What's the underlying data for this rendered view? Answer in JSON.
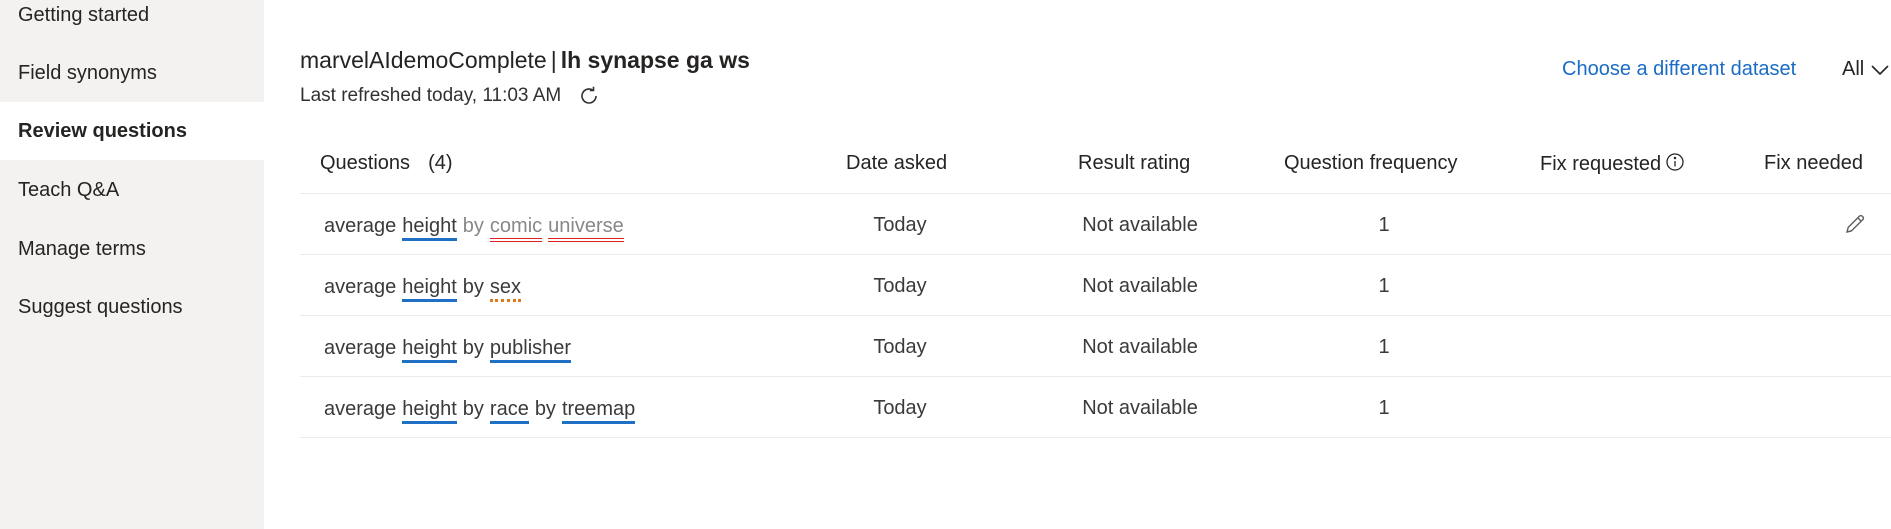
{
  "sidebar": {
    "items": [
      {
        "label": "Getting started",
        "active": false
      },
      {
        "label": "Field synonyms",
        "active": false
      },
      {
        "label": "Review questions",
        "active": true
      },
      {
        "label": "Teach Q&A",
        "active": false
      },
      {
        "label": "Manage terms",
        "active": false
      },
      {
        "label": "Suggest questions",
        "active": false
      }
    ]
  },
  "header": {
    "dataset": "marvelAIdemoComplete",
    "separator": "|",
    "workspace": "lh synapse ga ws",
    "last_refreshed": "Last refreshed today, 11:03 AM",
    "refresh_icon": "refresh-icon",
    "choose_dataset_link": "Choose a different dataset",
    "filter_value": "All",
    "filter_icon": "chevron-down-icon"
  },
  "table": {
    "columns": {
      "questions": "Questions",
      "questions_count": "(4)",
      "date_asked": "Date asked",
      "result_rating": "Result rating",
      "question_frequency": "Question frequency",
      "fix_requested": "Fix requested",
      "fix_needed": "Fix needed"
    },
    "rows": [
      {
        "words": [
          {
            "text": "average",
            "type": "plain"
          },
          {
            "text": "height",
            "type": "recognized"
          },
          {
            "text": "by",
            "type": "unknown-plain"
          },
          {
            "text": "comic",
            "type": "unrecognized"
          },
          {
            "text": "universe",
            "type": "unrecognized"
          }
        ],
        "date_asked": "Today",
        "result_rating": "Not available",
        "frequency": "1",
        "fix_needed_icon": "pencil-icon"
      },
      {
        "words": [
          {
            "text": "average",
            "type": "plain"
          },
          {
            "text": "height",
            "type": "recognized"
          },
          {
            "text": "by",
            "type": "plain"
          },
          {
            "text": "sex",
            "type": "uncertain"
          }
        ],
        "date_asked": "Today",
        "result_rating": "Not available",
        "frequency": "1"
      },
      {
        "words": [
          {
            "text": "average",
            "type": "plain"
          },
          {
            "text": "height",
            "type": "recognized"
          },
          {
            "text": "by",
            "type": "plain"
          },
          {
            "text": "publisher",
            "type": "recognized"
          }
        ],
        "date_asked": "Today",
        "result_rating": "Not available",
        "frequency": "1"
      },
      {
        "words": [
          {
            "text": "average",
            "type": "plain"
          },
          {
            "text": "height",
            "type": "recognized"
          },
          {
            "text": "by",
            "type": "plain"
          },
          {
            "text": "race",
            "type": "recognized"
          },
          {
            "text": "by",
            "type": "plain"
          },
          {
            "text": "treemap",
            "type": "recognized"
          }
        ],
        "date_asked": "Today",
        "result_rating": "Not available",
        "frequency": "1"
      }
    ]
  },
  "colors": {
    "link": "#1a6cc4",
    "recognized_underline": "#1f6fc5",
    "unrecognized_underline": "#e02020",
    "uncertain_underline": "#e2781d",
    "sidebar_bg": "#f3f2f1"
  }
}
